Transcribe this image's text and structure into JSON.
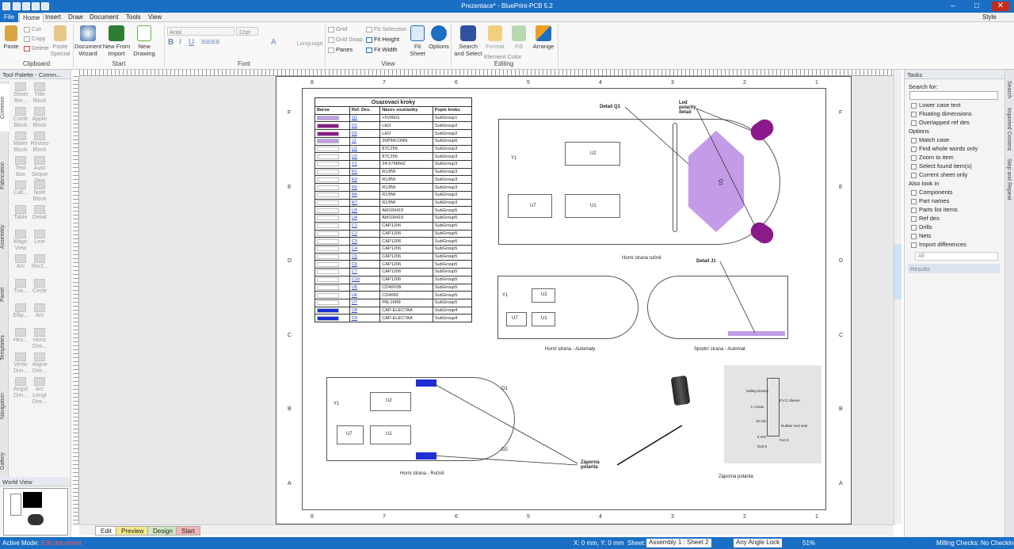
{
  "window": {
    "title": "Prezentace* - BluePrint-PCB 5.2",
    "style_label": "Style"
  },
  "menu": [
    "File",
    "Home",
    "Insert",
    "Draw",
    "Document",
    "Tools",
    "View"
  ],
  "ribbon": {
    "clipboard": {
      "paste": "Paste",
      "cut": "Cut",
      "copy": "Copy",
      "delete": "Delete",
      "paste_special": "Paste Special",
      "group": "Clipboard"
    },
    "start": {
      "document_wizard": "Document Wizard",
      "new_from_import": "New From Import",
      "new_drawing": "New Drawing",
      "group": "Start"
    },
    "font": {
      "family": "Arial",
      "size": "12pt",
      "language": "Language",
      "group": "Font"
    },
    "view": {
      "grid": "Grid",
      "grid_snap": "Grid Snap",
      "panes": "Panes",
      "fit_selection": "Fit Selection",
      "fit_height": "Fit Height",
      "fit_width": "Fit Width",
      "fit_sheet": "Fit Sheet",
      "options": "Options",
      "group": "View"
    },
    "editing": {
      "search_select": "Search and Select",
      "format": "Format",
      "element_color": "Element Color",
      "fill": "Fill",
      "arrange": "Arrange",
      "group": "Editing"
    }
  },
  "palette": {
    "title": "Tool Palette - Comm...",
    "tabs": [
      "Common",
      "Fabrication",
      "Assembly",
      "Panel",
      "Templates",
      "Navigation",
      "Gallery"
    ],
    "tools": [
      [
        "Sheet Bor...",
        "Title Block"
      ],
      [
        "Contir Block",
        "Applic Block"
      ],
      [
        "Mater Block",
        "Revisio Block"
      ],
      [
        "Text Box",
        "Auto Seque Text"
      ],
      [
        "Call...",
        "Note Block"
      ],
      [
        "Table",
        "Detail"
      ],
      [
        "Magn View",
        "Line"
      ],
      [
        "Arc",
        "Rect..."
      ],
      [
        "Tria...",
        "Circle"
      ],
      [
        "Ellip...",
        "Arc"
      ],
      [
        "Hex...",
        "Horiz Dim..."
      ],
      [
        "Vertic Dim...",
        "Aligne Dim..."
      ],
      [
        "Angul Dim...",
        "Arc Lengt Dim..."
      ]
    ]
  },
  "world_view": {
    "title": "World View"
  },
  "sheet": {
    "columns": [
      "8",
      "7",
      "6",
      "5",
      "4",
      "3",
      "2",
      "1"
    ],
    "rows": [
      "F",
      "E",
      "D",
      "C",
      "B",
      "A"
    ],
    "bom": {
      "title": "Osazovací kroky",
      "headers": [
        "Barva",
        "Ref. Des.",
        "Název součástky",
        "Popis kroku"
      ],
      "rows": [
        {
          "color": "#c39be6",
          "ref": "Q1",
          "part": "+5VREG",
          "step": "SubGroup1"
        },
        {
          "color": "#8b1a8b",
          "ref": "D1",
          "part": "LED",
          "step": "SubGroup2"
        },
        {
          "color": "#8b1a8b",
          "ref": "D2",
          "part": "LED",
          "step": "SubGroup2"
        },
        {
          "color": "#c39be6",
          "ref": "J1",
          "part": "26PINCONN",
          "step": "SubGroup6"
        },
        {
          "color": "#ffffff",
          "ref": "U1",
          "part": "87C256",
          "step": "SubGroup3"
        },
        {
          "color": "#ffffff",
          "ref": "U2",
          "part": "87C256",
          "step": "SubGroup3"
        },
        {
          "color": "#ffffff",
          "ref": "Y1",
          "part": "24-576MHZ",
          "step": "SubGroup3"
        },
        {
          "color": "#ffffff",
          "ref": "R1",
          "part": "R1/8W",
          "step": "SubGroup3"
        },
        {
          "color": "#ffffff",
          "ref": "R2",
          "part": "R1/8W",
          "step": "SubGroup3"
        },
        {
          "color": "#ffffff",
          "ref": "R5",
          "part": "R1/8W",
          "step": "SubGroup3"
        },
        {
          "color": "#ffffff",
          "ref": "R6",
          "part": "R1/8W",
          "step": "SubGroup3"
        },
        {
          "color": "#ffffff",
          "ref": "R7",
          "part": "R1/8W",
          "step": "SubGroup3"
        },
        {
          "color": "#ffffff",
          "ref": "U3",
          "part": "AM100415",
          "step": "SubGroup5"
        },
        {
          "color": "#ffffff",
          "ref": "U4",
          "part": "AM100415",
          "step": "SubGroup5"
        },
        {
          "color": "#ffffff",
          "ref": "C1",
          "part": "CAP1206",
          "step": "SubGroup5"
        },
        {
          "color": "#ffffff",
          "ref": "C2",
          "part": "CAP1206",
          "step": "SubGroup5"
        },
        {
          "color": "#ffffff",
          "ref": "C3",
          "part": "CAP1206",
          "step": "SubGroup5"
        },
        {
          "color": "#ffffff",
          "ref": "C4",
          "part": "CAP1206",
          "step": "SubGroup5"
        },
        {
          "color": "#ffffff",
          "ref": "C5",
          "part": "CAP1206",
          "step": "SubGroup5"
        },
        {
          "color": "#ffffff",
          "ref": "C6",
          "part": "CAP1206",
          "step": "SubGroup5"
        },
        {
          "color": "#ffffff",
          "ref": "C7",
          "part": "CAP1206",
          "step": "SubGroup5"
        },
        {
          "color": "#ffffff",
          "ref": "C10",
          "part": "CAP1206",
          "step": "SubGroup5"
        },
        {
          "color": "#ffffff",
          "ref": "U5",
          "part": "CD4001B",
          "step": "SubGroup5"
        },
        {
          "color": "#ffffff",
          "ref": "U6",
          "part": "CD4069",
          "step": "SubGroup5"
        },
        {
          "color": "#ffffff",
          "ref": "U7",
          "part": "PAL16R8",
          "step": "SubGroup5"
        },
        {
          "color": "#1e2fd8",
          "ref": "C8",
          "part": "CAP-ELECTAA",
          "step": "SubGroup4"
        },
        {
          "color": "#1e2fd8",
          "ref": "C9",
          "part": "CAP-ELECTAA",
          "step": "SubGroup4"
        }
      ]
    },
    "labels": {
      "detail_q1": "Detail Q1",
      "led": "Led",
      "polarity": "polarity",
      "detail": "detail",
      "top_manual": "Horní strana ručně",
      "detail_j1": "Detail J1",
      "top_auto": "Horní strana - Automaty",
      "bottom_auto": "Spodní strana - Automat",
      "top_manual2": "Horní strana - Ručně",
      "neg_polarity_1": "Záporná",
      "neg_polarity_2": "polarita",
      "neg_polarity_caption": "Záporná polarita",
      "u2": "U2",
      "u1": "U1",
      "u7": "U7",
      "y1": "Y1",
      "q1": "Q1",
      "d1": "D1",
      "d2": "D2"
    },
    "photo_labels": {
      "safety": "Safety Device",
      "sleeve": "P.V.C.Sleeve",
      "l": "L+1max",
      "rubber": "Rubber end seal",
      "f": "F±0.5",
      "d": "D±0.5",
      "l15": "15 min",
      "l5": "5 min"
    }
  },
  "tasks": {
    "title": "Tasks",
    "search_for": "Search for:",
    "checks_a": [
      "Lower case text",
      "Floating dimensions",
      "Overlapped ref des"
    ],
    "options_label": "Options",
    "checks_b": [
      "Match case",
      "Find whole words only",
      "Zoom to item",
      "Select found item(s)",
      "Current sheet only"
    ],
    "also_label": "Also look in",
    "checks_c": [
      "Components",
      "Part names",
      "Parts list items",
      "Ref des",
      "Drills",
      "Nets",
      "Import differences"
    ],
    "scope": "All",
    "results": "Results"
  },
  "right_tabs": [
    "Search",
    "Imported Content",
    "Step and Repeat"
  ],
  "sheet_tabs": [
    "Edit",
    "Preview",
    "Design",
    "Start"
  ],
  "status": {
    "mode_label": "Active Mode:",
    "mode_value": "Edit document",
    "coords": "X: 0 mm, Y: 0 mm",
    "sheet_label": "Sheet:",
    "sheet_value": "Assembly 1 : Sheet 2",
    "angle": "Any Angle Lock",
    "zoom": "51%",
    "milling": "Milling Checks: No Checking"
  },
  "colors": {
    "accent": "#1a6fc4",
    "purple": "#c39be6",
    "dark_purple": "#8b1a8b",
    "blue": "#1e2fd8"
  }
}
